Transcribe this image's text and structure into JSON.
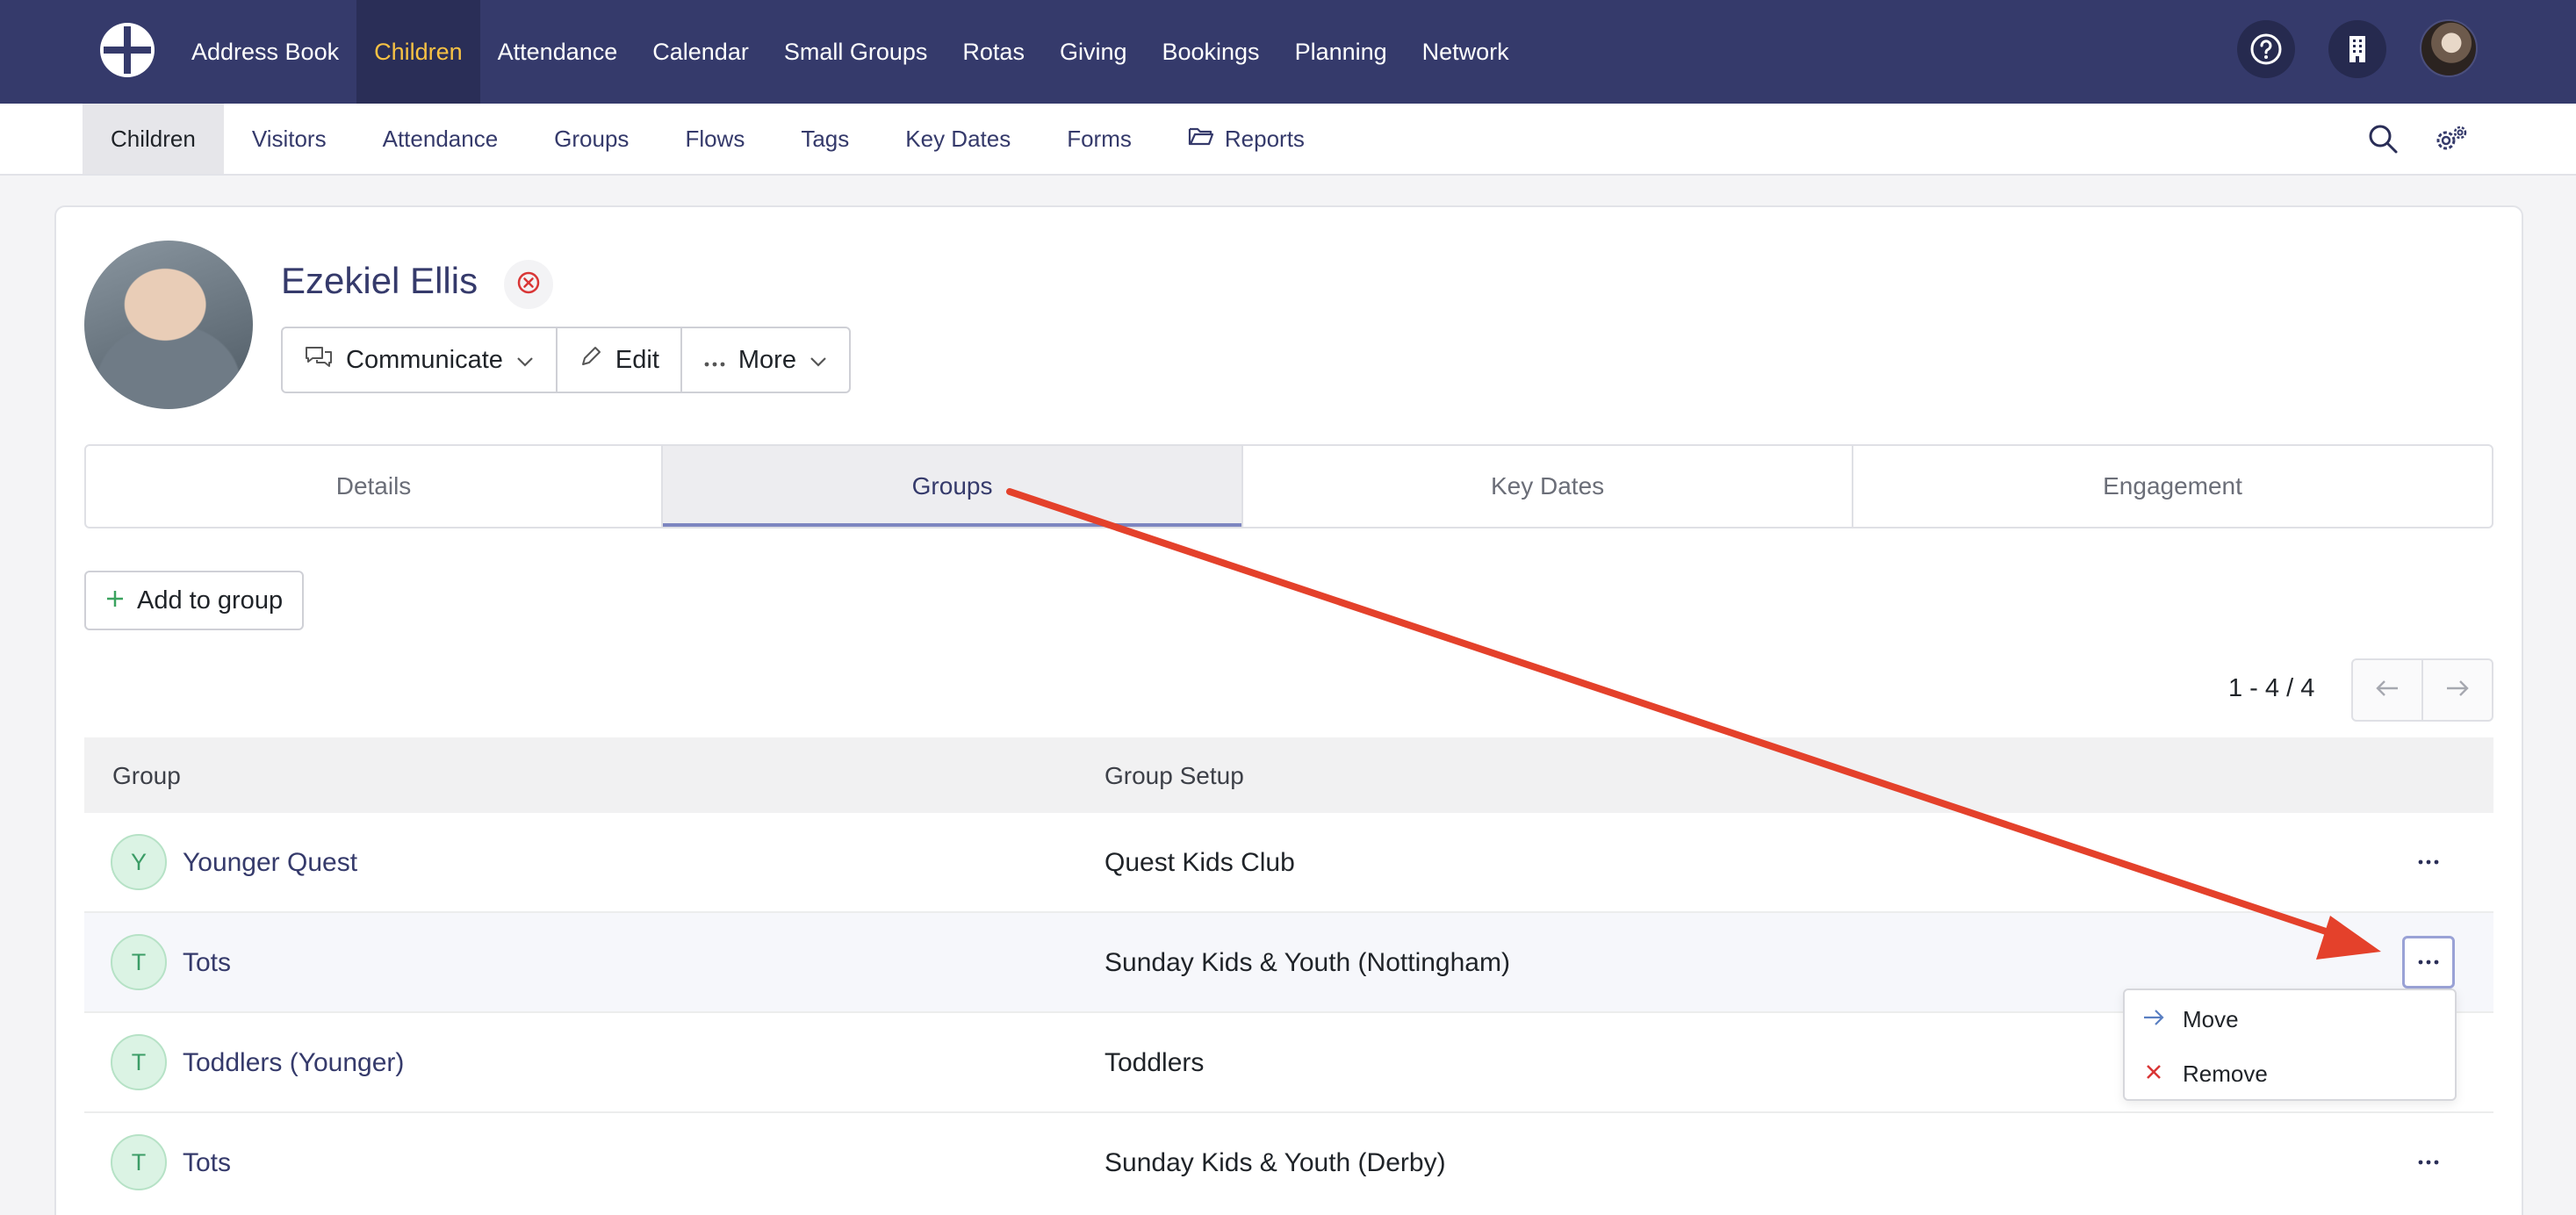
{
  "topnav": {
    "items": [
      {
        "label": "Address Book"
      },
      {
        "label": "Children",
        "active": true
      },
      {
        "label": "Attendance"
      },
      {
        "label": "Calendar"
      },
      {
        "label": "Small Groups"
      },
      {
        "label": "Rotas"
      },
      {
        "label": "Giving"
      },
      {
        "label": "Bookings"
      },
      {
        "label": "Planning"
      },
      {
        "label": "Network"
      }
    ],
    "icons": [
      "logo-icon",
      "help-icon",
      "building-icon",
      "user-avatar"
    ],
    "active_color": "#f7c244",
    "bar_color": "#353a6b"
  },
  "subnav": {
    "items": [
      {
        "label": "Children",
        "active": true
      },
      {
        "label": "Visitors"
      },
      {
        "label": "Attendance"
      },
      {
        "label": "Groups"
      },
      {
        "label": "Flows"
      },
      {
        "label": "Tags"
      },
      {
        "label": "Key Dates"
      },
      {
        "label": "Forms"
      },
      {
        "label": "Reports",
        "icon": "folder-open-icon"
      }
    ],
    "icons": [
      "search-icon",
      "settings-icon"
    ]
  },
  "profile": {
    "name": "Ezekiel Ellis",
    "actions": {
      "communicate": "Communicate",
      "edit": "Edit",
      "more": "More"
    }
  },
  "tabs": [
    {
      "label": "Details"
    },
    {
      "label": "Groups",
      "active": true
    },
    {
      "label": "Key Dates"
    },
    {
      "label": "Engagement"
    }
  ],
  "add_to_group": "Add to group",
  "pagination": {
    "text": "1 - 4 / 4"
  },
  "table": {
    "headers": {
      "group": "Group",
      "group_setup": "Group Setup"
    },
    "rows": [
      {
        "initial": "Y",
        "group": "Younger Quest",
        "setup": "Quest Kids Club"
      },
      {
        "initial": "T",
        "group": "Tots",
        "setup": "Sunday Kids & Youth (Nottingham)",
        "menu_open": true
      },
      {
        "initial": "T",
        "group": "Toddlers (Younger)",
        "setup": "Toddlers"
      },
      {
        "initial": "T",
        "group": "Tots",
        "setup": "Sunday Kids & Youth (Derby)"
      }
    ]
  },
  "row_menu": {
    "move": "Move",
    "remove": "Remove"
  },
  "annotation_color": "#e4412b"
}
